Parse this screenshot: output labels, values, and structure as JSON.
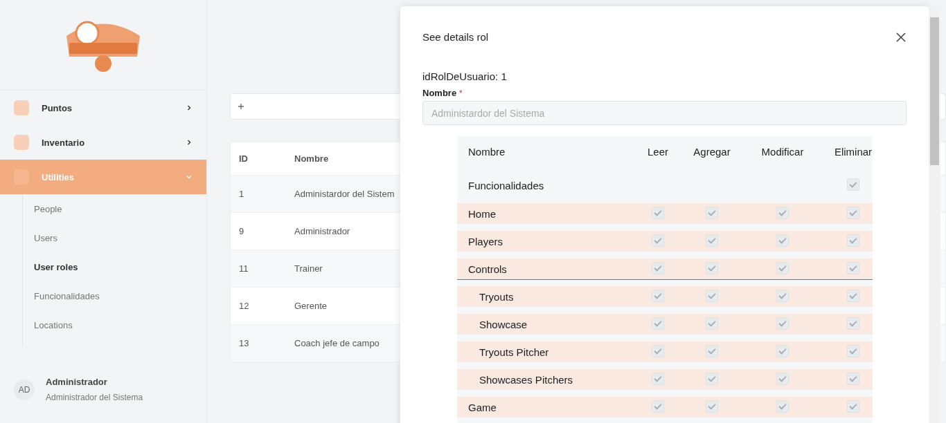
{
  "sidebar": {
    "items": [
      {
        "label": "Puntos",
        "selected": false,
        "expanded": false
      },
      {
        "label": "Inventario",
        "selected": false,
        "expanded": false
      },
      {
        "label": "Utilities",
        "selected": true,
        "expanded": true,
        "children": [
          {
            "label": "People",
            "selected": false
          },
          {
            "label": "Users",
            "selected": false
          },
          {
            "label": "User roles",
            "selected": true
          },
          {
            "label": "Funcionalidades",
            "selected": false
          },
          {
            "label": "Locations",
            "selected": false
          }
        ]
      }
    ],
    "user": {
      "initials": "AD",
      "name": "Administrador",
      "role": "Administrador del Sistema"
    }
  },
  "table": {
    "columns": [
      "ID",
      "Nombre"
    ],
    "rows": [
      [
        "1",
        "Administardor del Sistem"
      ],
      [
        "9",
        "Administrador"
      ],
      [
        "11",
        "Trainer"
      ],
      [
        "12",
        "Gerente"
      ],
      [
        "13",
        "Coach jefe de campo"
      ]
    ]
  },
  "modal": {
    "title": "See details rol",
    "id_line": "idRolDeUsuario: 1",
    "name_label": "Nombre",
    "required_mark": "*",
    "name_placeholder": "Administardor del Sistema",
    "permissions": {
      "columns": [
        "Nombre",
        "Leer",
        "Agregar",
        "Modificar",
        "Eliminar"
      ],
      "group": {
        "label": "Funcionalidades",
        "all_checked": true
      },
      "rows": [
        {
          "label": "Home",
          "read": true,
          "add": true,
          "modify": true,
          "delete": true
        },
        {
          "label": "Players",
          "read": true,
          "add": true,
          "modify": true,
          "delete": true
        },
        {
          "label": "Controls",
          "read": true,
          "add": true,
          "modify": true,
          "delete": true,
          "children": [
            {
              "label": "Tryouts",
              "read": true,
              "add": true,
              "modify": true,
              "delete": true
            },
            {
              "label": "Showcase",
              "read": true,
              "add": true,
              "modify": true,
              "delete": true
            },
            {
              "label": "Tryouts Pitcher",
              "read": true,
              "add": true,
              "modify": true,
              "delete": true
            },
            {
              "label": "Showcases Pitchers",
              "read": true,
              "add": true,
              "modify": true,
              "delete": true
            }
          ]
        },
        {
          "label": "Game",
          "read": true,
          "add": true,
          "modify": true,
          "delete": true
        }
      ]
    }
  }
}
